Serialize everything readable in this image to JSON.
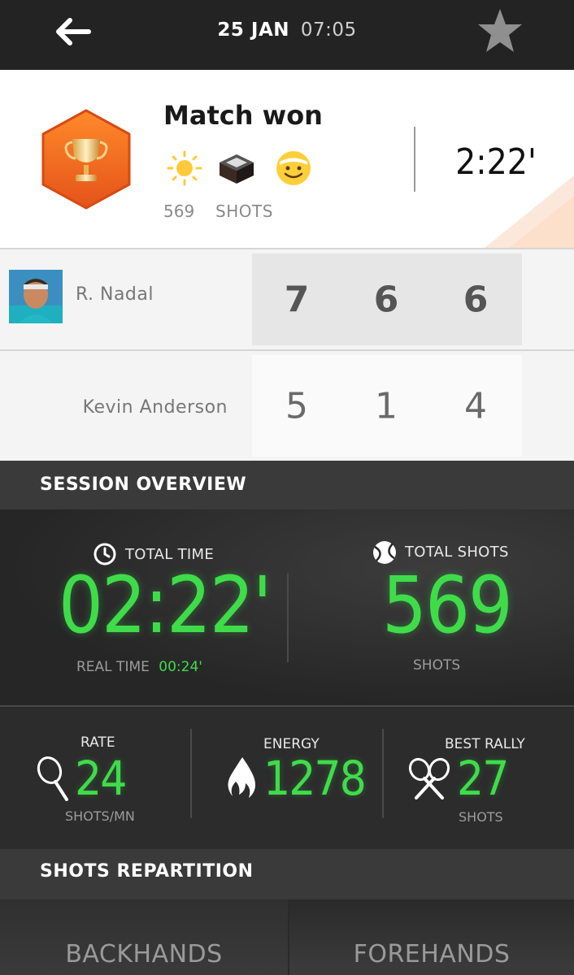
{
  "header": {
    "date": "25 JAN",
    "time": "07:05"
  },
  "summary": {
    "result": "Match won",
    "shots_count": "569",
    "shots_label": "SHOTS",
    "duration": "2:22'"
  },
  "scoreboard": {
    "player1": {
      "name": "R. Nadal",
      "sets": [
        "7",
        "6",
        "6"
      ]
    },
    "player2": {
      "name": "Kevin Anderson",
      "sets": [
        "5",
        "1",
        "4"
      ]
    }
  },
  "overview": {
    "title": "SESSION OVERVIEW",
    "total_time_label": "TOTAL TIME",
    "total_time_value": "02:22'",
    "real_time_label": "REAL TIME",
    "real_time_value": "00:24'",
    "total_shots_label": "TOTAL SHOTS",
    "total_shots_value": "569",
    "total_shots_unit": "SHOTS"
  },
  "metrics": {
    "rate": {
      "label": "RATE",
      "value": "24",
      "unit": "SHOTS/MN"
    },
    "energy": {
      "label": "ENERGY",
      "value": "1278"
    },
    "best_rally": {
      "label": "BEST RALLY",
      "value": "27",
      "unit": "SHOTS"
    }
  },
  "repartition": {
    "title": "SHOTS REPARTITION",
    "tabs": [
      "BACKHANDS",
      "FOREHANDS"
    ]
  },
  "colors": {
    "accent_green": "#3fdc4a",
    "trophy_orange": "#f06a1a",
    "header_bg": "#232323"
  },
  "icons": [
    "back-arrow-icon",
    "star-icon",
    "trophy-icon",
    "sun-icon",
    "indoor-court-icon",
    "smiley-icon",
    "clock-icon",
    "tennis-ball-icon",
    "racket-icon",
    "flame-icon",
    "crossed-rackets-icon"
  ]
}
